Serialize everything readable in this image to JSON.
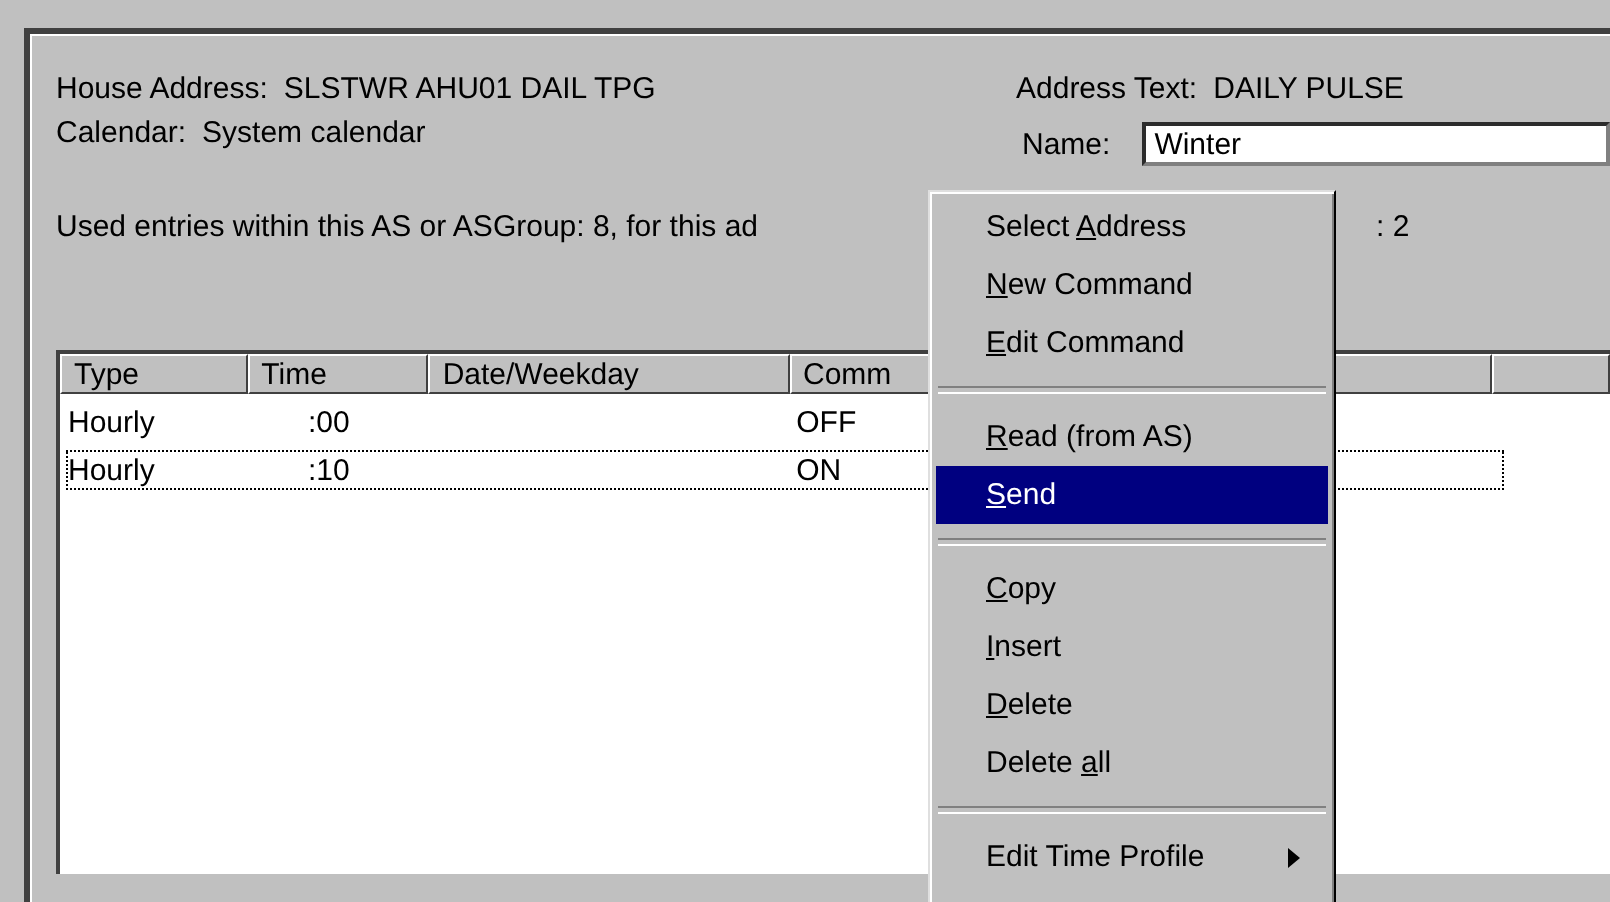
{
  "header": {
    "house_address_label": "House Address:",
    "house_address": "SLSTWR AHU01 DAIL TPG",
    "calendar_label": "Calendar:",
    "calendar": "System calendar",
    "address_text_label": "Address Text:",
    "address_text": "DAILY PULSE",
    "name_label": "Name:",
    "name_value": "Winter"
  },
  "usage": {
    "text_left": "Used entries within this AS or ASGroup: 8, for this ad",
    "text_right": ": 2"
  },
  "table": {
    "columns": [
      "Type",
      "Time",
      "Date/Weekday",
      "Comm",
      ""
    ],
    "rows": [
      {
        "type": "Hourly",
        "time": ":00",
        "command": "OFF",
        "focused": false
      },
      {
        "type": "Hourly",
        "time": ":10",
        "command": "ON",
        "focused": true
      }
    ]
  },
  "context_menu": {
    "items": [
      {
        "kind": "item",
        "label": {
          "before": "Select ",
          "key": "A",
          "after": "ddress"
        },
        "selected": false
      },
      {
        "kind": "item",
        "label": {
          "key": "N",
          "after": "ew Command"
        },
        "selected": false
      },
      {
        "kind": "item",
        "label": {
          "key": "E",
          "after": "dit Command"
        },
        "selected": false
      },
      {
        "kind": "separator"
      },
      {
        "kind": "item",
        "label": {
          "key": "R",
          "after": "ead (from AS)"
        },
        "selected": false
      },
      {
        "kind": "item",
        "label": {
          "key": "S",
          "after": "end"
        },
        "selected": true
      },
      {
        "kind": "separator"
      },
      {
        "kind": "item",
        "label": {
          "key": "C",
          "after": "opy"
        },
        "selected": false
      },
      {
        "kind": "item",
        "label": {
          "key": "I",
          "after": "nsert"
        },
        "selected": false
      },
      {
        "kind": "item",
        "label": {
          "key": "D",
          "after": "elete"
        },
        "selected": false
      },
      {
        "kind": "item",
        "label": {
          "before": "Delete ",
          "key": "a",
          "after": "ll"
        },
        "selected": false
      },
      {
        "kind": "separator"
      },
      {
        "kind": "submenu",
        "label": {
          "before": "Edit Time Profile"
        },
        "selected": false
      }
    ]
  }
}
